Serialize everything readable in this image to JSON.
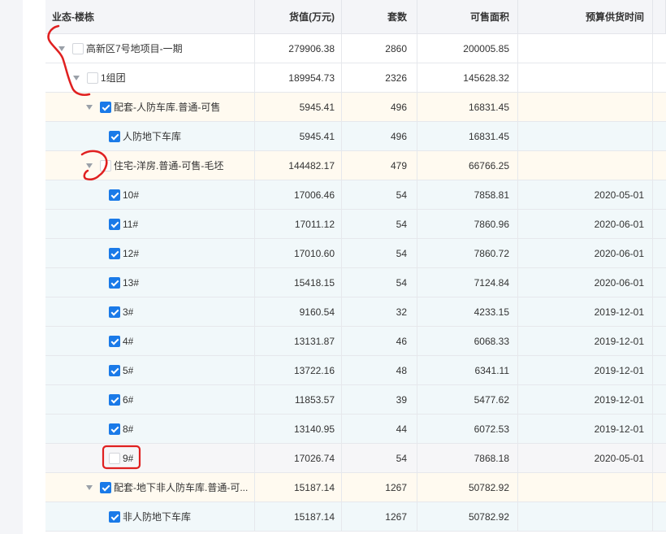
{
  "headers": {
    "name": "业态-楼栋",
    "value": "货值(万元)",
    "units": "套数",
    "area": "可售面积",
    "supply_time": "预算供货时间"
  },
  "rows": [
    {
      "label": "高新区7号地项目-一期",
      "value": "279906.38",
      "units": "2860",
      "area": "200005.85",
      "date": "",
      "level": 0,
      "checked": false,
      "expand": true,
      "tone": "white"
    },
    {
      "label": "1组团",
      "value": "189954.73",
      "units": "2326",
      "area": "145628.32",
      "date": "",
      "level": 1,
      "checked": false,
      "expand": true,
      "tone": "white"
    },
    {
      "label": "配套-人防车库.普通-可售",
      "value": "5945.41",
      "units": "496",
      "area": "16831.45",
      "date": "",
      "level": 2,
      "checked": true,
      "expand": true,
      "tone": "yellow"
    },
    {
      "label": "人防地下车库",
      "value": "5945.41",
      "units": "496",
      "area": "16831.45",
      "date": "",
      "level": 3,
      "checked": true,
      "expand": false,
      "tone": "blue"
    },
    {
      "label": "住宅-洋房.普通-可售-毛坯",
      "value": "144482.17",
      "units": "479",
      "area": "66766.25",
      "date": "",
      "level": 2,
      "checked": false,
      "expand": true,
      "tone": "yellow"
    },
    {
      "label": "10#",
      "value": "17006.46",
      "units": "54",
      "area": "7858.81",
      "date": "2020-05-01",
      "level": 3,
      "checked": true,
      "expand": false,
      "tone": "blue"
    },
    {
      "label": "11#",
      "value": "17011.12",
      "units": "54",
      "area": "7860.96",
      "date": "2020-06-01",
      "level": 3,
      "checked": true,
      "expand": false,
      "tone": "blue"
    },
    {
      "label": "12#",
      "value": "17010.60",
      "units": "54",
      "area": "7860.72",
      "date": "2020-06-01",
      "level": 3,
      "checked": true,
      "expand": false,
      "tone": "blue"
    },
    {
      "label": "13#",
      "value": "15418.15",
      "units": "54",
      "area": "7124.84",
      "date": "2020-06-01",
      "level": 3,
      "checked": true,
      "expand": false,
      "tone": "blue"
    },
    {
      "label": "3#",
      "value": "9160.54",
      "units": "32",
      "area": "4233.15",
      "date": "2019-12-01",
      "level": 3,
      "checked": true,
      "expand": false,
      "tone": "blue"
    },
    {
      "label": "4#",
      "value": "13131.87",
      "units": "46",
      "area": "6068.33",
      "date": "2019-12-01",
      "level": 3,
      "checked": true,
      "expand": false,
      "tone": "blue"
    },
    {
      "label": "5#",
      "value": "13722.16",
      "units": "48",
      "area": "6341.11",
      "date": "2019-12-01",
      "level": 3,
      "checked": true,
      "expand": false,
      "tone": "blue"
    },
    {
      "label": "6#",
      "value": "11853.57",
      "units": "39",
      "area": "5477.62",
      "date": "2019-12-01",
      "level": 3,
      "checked": true,
      "expand": false,
      "tone": "blue"
    },
    {
      "label": "8#",
      "value": "13140.95",
      "units": "44",
      "area": "6072.53",
      "date": "2019-12-01",
      "level": 3,
      "checked": true,
      "expand": false,
      "tone": "blue"
    },
    {
      "label": "9#",
      "value": "17026.74",
      "units": "54",
      "area": "7868.18",
      "date": "2020-05-01",
      "level": 3,
      "checked": false,
      "expand": false,
      "tone": "grey"
    },
    {
      "label": "配套-地下非人防车库.普通-可...",
      "value": "15187.14",
      "units": "1267",
      "area": "50782.92",
      "date": "",
      "level": 2,
      "checked": true,
      "expand": true,
      "tone": "yellow"
    },
    {
      "label": "非人防地下车库",
      "value": "15187.14",
      "units": "1267",
      "area": "50782.92",
      "date": "",
      "level": 3,
      "checked": true,
      "expand": false,
      "tone": "blue"
    }
  ],
  "colors": {
    "accent": "#1a7ae8",
    "annotation": "#e02020"
  }
}
